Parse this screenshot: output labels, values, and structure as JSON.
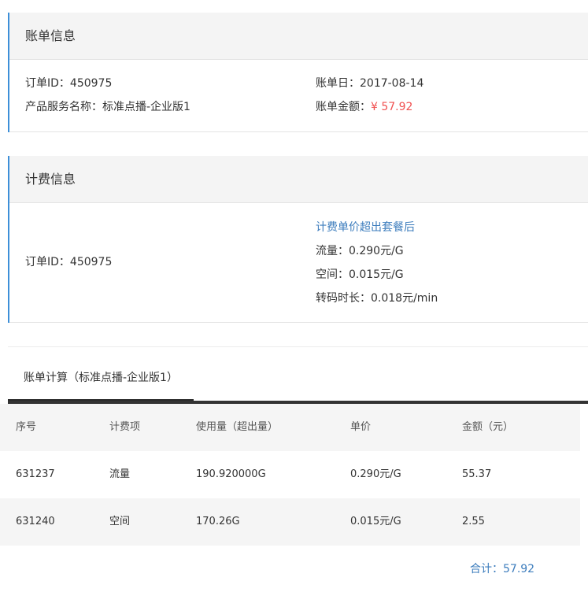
{
  "bill_info": {
    "title": "账单信息",
    "order_id": "订单ID：450975",
    "product_name": "产品服务名称：标准点播-企业版1",
    "bill_date": "账单日：2017-08-14",
    "amount_label": "账单金额：",
    "amount_value": "¥ 57.92"
  },
  "billing_info": {
    "title": "计费信息",
    "order_id": "订单ID：450975",
    "rate_heading": "计费单价超出套餐后",
    "traffic_rate": "流量：0.290元/G",
    "space_rate": "空间：0.015元/G",
    "transcode_rate": "转码时长：0.018元/min"
  },
  "calc_tab": {
    "label": "账单计算（标准点播-企业版1）"
  },
  "table": {
    "headers": [
      "序号",
      "计费项",
      "使用量（超出量）",
      "单价",
      "金额（元）"
    ],
    "rows": [
      [
        "631237",
        "流量",
        "190.920000G",
        "0.290元/G",
        "55.37"
      ],
      [
        "631240",
        "空间",
        "170.26G",
        "0.015元/G",
        "2.55"
      ]
    ]
  },
  "total": "合计：57.92",
  "colors": {
    "accent_blue": "#3d7dbd",
    "amount_red": "#f05050",
    "panel_border": "#3d8fd8"
  }
}
